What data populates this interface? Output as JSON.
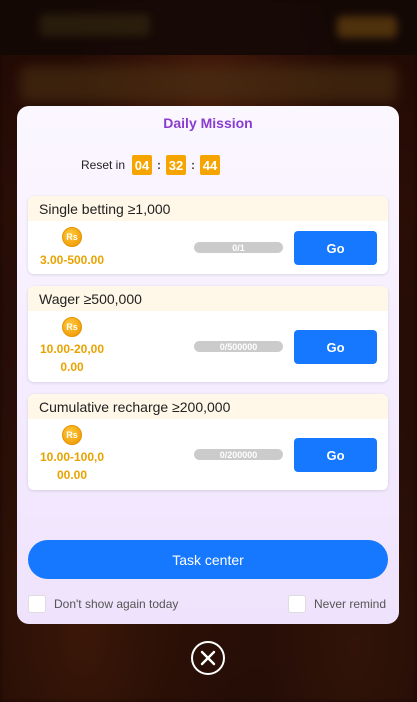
{
  "modal": {
    "title": "Daily Mission",
    "reset": {
      "label": "Reset in",
      "hours": "04",
      "minutes": "32",
      "seconds": "44",
      "separator": ":"
    },
    "missions": [
      {
        "title": "Single betting ≥1,000",
        "coin_symbol": "Rs",
        "reward_lines": [
          "3.00-500.00"
        ],
        "progress_text": "0/1",
        "progress_fraction": 0,
        "button_label": "Go"
      },
      {
        "title": "Wager ≥500,000",
        "coin_symbol": "Rs",
        "reward_lines": [
          "10.00-20,00",
          "0.00"
        ],
        "progress_text": "0/500000",
        "progress_fraction": 0,
        "button_label": "Go"
      },
      {
        "title": "Cumulative recharge ≥200,000",
        "coin_symbol": "Rs",
        "reward_lines": [
          "10.00-100,0",
          "00.00"
        ],
        "progress_text": "0/200000",
        "progress_fraction": 0,
        "button_label": "Go"
      }
    ],
    "task_center_label": "Task center",
    "dont_show_today_label": "Don't show again today",
    "never_remind_label": "Never remind"
  },
  "colors": {
    "accent_blue": "#1677ff",
    "title_purple": "#8a3ccf",
    "reward_gold": "#e8a300",
    "timer_orange": "#f5a400"
  },
  "icons": {
    "close": "close-icon",
    "coin": "rupee-coin-icon"
  }
}
